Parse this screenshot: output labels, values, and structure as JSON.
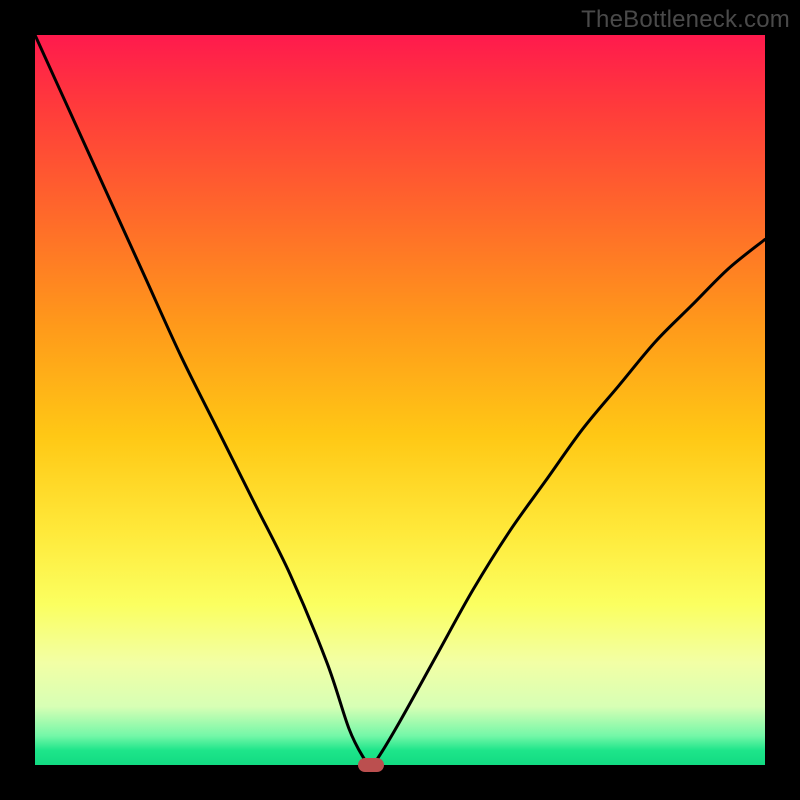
{
  "watermark": "TheBottleneck.com",
  "chart_data": {
    "type": "line",
    "title": "",
    "xlabel": "",
    "ylabel": "",
    "xlim": [
      0,
      100
    ],
    "ylim": [
      0,
      100
    ],
    "series": [
      {
        "name": "bottleneck-curve",
        "x": [
          0,
          5,
          10,
          15,
          20,
          25,
          30,
          35,
          40,
          43,
          45,
          46,
          47,
          50,
          55,
          60,
          65,
          70,
          75,
          80,
          85,
          90,
          95,
          100
        ],
        "y": [
          100,
          89,
          78,
          67,
          56,
          46,
          36,
          26,
          14,
          5,
          1,
          0,
          1,
          6,
          15,
          24,
          32,
          39,
          46,
          52,
          58,
          63,
          68,
          72
        ]
      }
    ],
    "marker": {
      "x": 46,
      "y": 0
    },
    "gradient_meaning": "red (high bottleneck) → green (no bottleneck)"
  }
}
